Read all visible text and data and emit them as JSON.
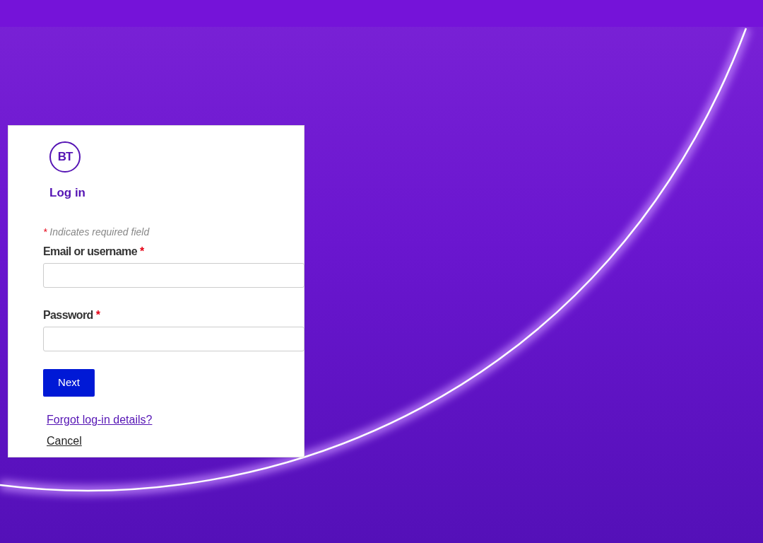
{
  "logo": {
    "text": "BT"
  },
  "heading": "Log in",
  "required_note": {
    "mark": "*",
    "text": "Indicates required field"
  },
  "fields": [
    {
      "label": "Email or username",
      "required_mark": "*"
    },
    {
      "label": "Password",
      "required_mark": "*"
    }
  ],
  "next_button": "Next",
  "links": [
    {
      "text": "Forgot log-in details?",
      "kind": "help"
    },
    {
      "text": "Cancel",
      "kind": "cancel"
    }
  ]
}
